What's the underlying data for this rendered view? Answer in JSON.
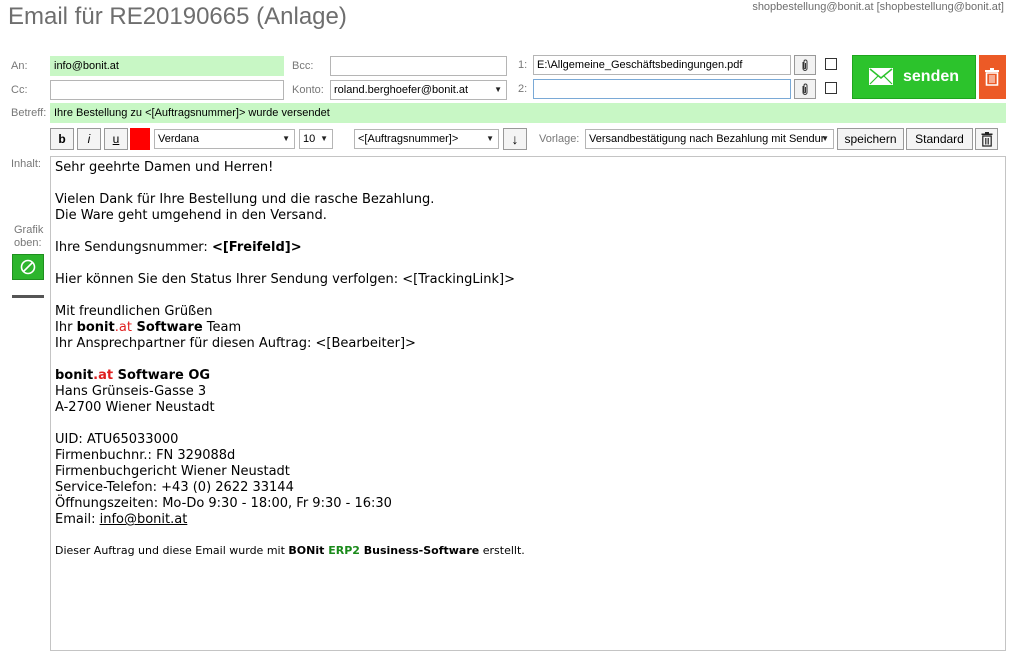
{
  "window": {
    "title": "Email für RE20190665 (Anlage)",
    "account": "shopbestellung@bonit.at [shopbestellung@bonit.at]"
  },
  "header": {
    "an_label": "An:",
    "an_value": "info@bonit.at",
    "cc_label": "Cc:",
    "cc_value": "",
    "bcc_label": "Bcc:",
    "bcc_value": "",
    "konto_label": "Konto:",
    "konto_value": "roland.berghoefer@bonit.at",
    "attach1_label": "1:",
    "attach1_value": "E:\\Allgemeine_Geschäftsbedingungen.pdf",
    "attach2_label": "2:",
    "attach2_value": "",
    "betreff_label": "Betreff:",
    "betreff_value": "Ihre Bestellung zu <[Auftragsnummer]> wurde versendet",
    "send_label": "senden"
  },
  "toolbar": {
    "bold": "b",
    "italic": "i",
    "underline": "u",
    "color": "#ff0000",
    "font": "Verdana",
    "size": "10",
    "placeholder": "<[Auftragsnummer]>",
    "insert_arrow": "↓",
    "vorlage_label": "Vorlage:",
    "vorlage_value": "Versandbestätigung nach Bezahlung mit Sendur",
    "save_label": "speichern",
    "standard_label": "Standard"
  },
  "side": {
    "inhalt_label": "Inhalt:",
    "grafik_label_1": "Grafik",
    "grafik_label_2": "oben:"
  },
  "body": {
    "l1": "Sehr geehrte Damen und Herren!",
    "l2": "Vielen Dank für Ihre Bestellung und die rasche Bezahlung.",
    "l3": "Die Ware geht umgehend in den Versand.",
    "l4_a": "Ihre Sendungsnummer: ",
    "l4_b": "<[Freifeld]>",
    "l5": "Hier können Sie den Status Ihrer Sendung verfolgen: <[TrackingLink]>",
    "l6": "Mit freundlichen Grüßen",
    "l7_a": "Ihr ",
    "l7_b": "bonit",
    "l7_c": ".at",
    "l7_d": " Software",
    "l7_e": " Team",
    "l8": "Ihr Ansprechpartner für diesen Auftrag: <[Bearbeiter]>",
    "l9_a": "bonit",
    "l9_b": ".at",
    "l9_c": " Software OG",
    "l10": "Hans Grünseis-Gasse 3",
    "l11": "A-2700 Wiener Neustadt",
    "l12": "UID: ATU65033000",
    "l13": "Firmenbuchnr.: FN 329088d",
    "l14": "Firmenbuchgericht Wiener Neustadt",
    "l15": "Service-Telefon: +43 (0) 2622 33144",
    "l16": "Öffnungszeiten: Mo-Do 9:30 - 18:00, Fr 9:30 - 16:30",
    "l17_a": "Email: ",
    "l17_b": "info@bonit.at",
    "l18_a": "Dieser Auftrag und diese Email wurde mit ",
    "l18_b": "BONit",
    "l18_c": " ERP2",
    "l18_d": " Business-Software",
    "l18_e": " erstellt."
  }
}
